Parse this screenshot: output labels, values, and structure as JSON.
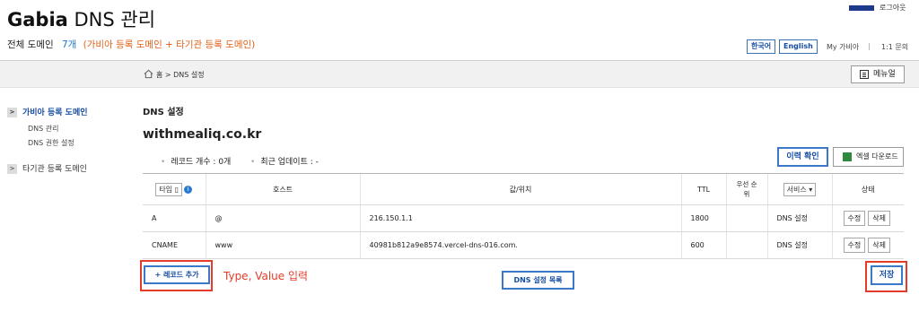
{
  "header": {
    "brand_bold": "Gabia",
    "brand_rest": " DNS 관리",
    "subtitle_label": "전체 도메인",
    "subtitle_count": "7개",
    "subtitle_note": "(가비아 등록 도메인 + 타기관 등록 도메인)",
    "logout": "로그아웃",
    "lang_ko": "한국어",
    "lang_en": "English",
    "my_gabia": "My 가비아",
    "separator": "|",
    "inquiry": "1:1 문의"
  },
  "breadcrumb": {
    "text": "홈 > DNS 설정",
    "manual_label": "메뉴얼"
  },
  "sidebar": {
    "group1": "가비아 등록 도메인",
    "sub1": "DNS 관리",
    "sub2": "DNS 권한 설정",
    "group2": "타기관 등록 도메인",
    "arrow": ">"
  },
  "main": {
    "section_title": "DNS 설정",
    "domain": "withmealiq.co.kr",
    "record_count": "레코드 개수 : 0개",
    "last_update": "최근 업데이트 : -",
    "history_button": "이력 확인",
    "excel_button": "엑셀 다운로드"
  },
  "table": {
    "type_select": "타입 ▯",
    "type_info": "i",
    "col_host": "호스트",
    "col_value": "값/위치",
    "col_ttl": "TTL",
    "col_priority": "우선 순위",
    "service_select": "서비스",
    "col_status": "상태",
    "rows": [
      {
        "type": "A",
        "host": "@",
        "value": "216.150.1.1",
        "ttl": "1800",
        "priority": "",
        "service": "DNS 설정",
        "edit": "수정",
        "delete": "삭제"
      },
      {
        "type": "CNAME",
        "host": "www",
        "value": "40981b812a9e8574.vercel-dns-016.com.",
        "ttl": "600",
        "priority": "",
        "service": "DNS 설정",
        "edit": "수정",
        "delete": "삭제"
      }
    ]
  },
  "actions": {
    "add_record": "+ 레코드 추가",
    "hint": "Type, Value 입력",
    "dns_list": "DNS 설정 목록",
    "save": "저장"
  },
  "colors": {
    "accent_blue": "#3a78c8",
    "annotation_red": "#e53c2a",
    "count_blue": "#1a73d1",
    "note_orange": "#e2621a"
  }
}
